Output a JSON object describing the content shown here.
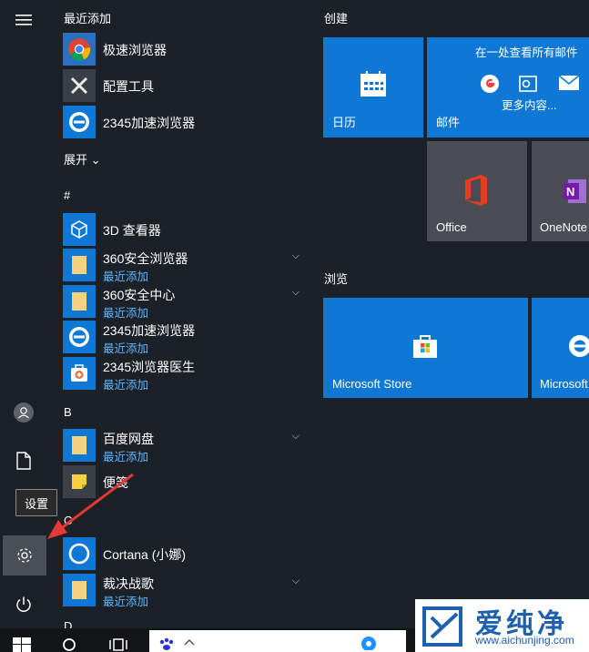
{
  "recent": {
    "header": "最近添加",
    "items": [
      {
        "name": "极速浏览器"
      },
      {
        "name": "配置工具"
      },
      {
        "name": "2345加速浏览器"
      }
    ]
  },
  "expand": {
    "label": "展开",
    "chevron": "⌄"
  },
  "group_hash": {
    "header": "#",
    "items": [
      {
        "name": "3D 查看器",
        "sub": ""
      },
      {
        "name": "360安全浏览器",
        "sub": "最近添加"
      },
      {
        "name": "360安全中心",
        "sub": "最近添加"
      },
      {
        "name": "2345加速浏览器",
        "sub": "最近添加"
      },
      {
        "name": "2345浏览器医生",
        "sub": "最近添加"
      }
    ]
  },
  "group_b": {
    "header": "B",
    "items": [
      {
        "name": "百度网盘",
        "sub": "最近添加"
      },
      {
        "name": "便笺",
        "sub": ""
      }
    ]
  },
  "group_c": {
    "header": "C",
    "items": [
      {
        "name": "Cortana (小娜)",
        "sub": ""
      },
      {
        "name": "裁决战歌",
        "sub": "最近添加"
      }
    ]
  },
  "group_d": {
    "header": "D"
  },
  "tooltip": "设置",
  "tiles": {
    "create_header": "创建",
    "browse_header": "浏览",
    "calendar": "日历",
    "mail": {
      "label": "邮件",
      "headline": "在一处查看所有邮件",
      "more": "更多内容..."
    },
    "office": "Office",
    "onenote": "OneNote",
    "store": "Microsoft Store",
    "edge": "Microsoft Edge"
  },
  "watermark": {
    "brand": "爱纯净",
    "url": "www.aichunjing.com"
  },
  "colors": {
    "accent": "#0f78d4",
    "bg": "#1c2027",
    "recent_label": "#5cb6ff",
    "arrow": "#e53935"
  }
}
